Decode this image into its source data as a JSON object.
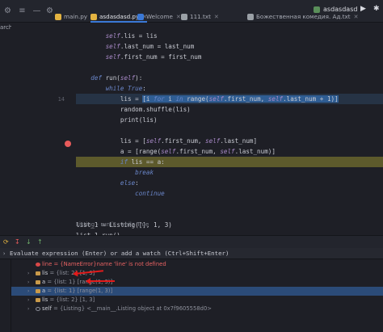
{
  "tabs": [
    {
      "label": "main.py",
      "active": false,
      "icon_color": "#e3b341"
    },
    {
      "label": "asdasdasd.py",
      "active": true,
      "icon_color": "#e3b341"
    },
    {
      "label": "Welcome",
      "active": false,
      "icon_color": "#3a78d6"
    },
    {
      "label": "111.txt",
      "active": false,
      "icon_color": "#9aa0a6"
    },
    {
      "label": "Божественная комедия. Ад.txt",
      "active": false,
      "icon_color": "#9aa0a6"
    }
  ],
  "run_config": {
    "name": "asdasdasd"
  },
  "left_panel": {
    "search_label": "arch"
  },
  "code_lines": [
    {
      "no": "",
      "html": "        <span class='self'>self</span>.lis = lis"
    },
    {
      "no": "",
      "html": "        <span class='self'>self</span>.last_num = last_num"
    },
    {
      "no": "",
      "html": "        <span class='self'>self</span>.first_num = first_num"
    },
    {
      "no": "",
      "html": ""
    },
    {
      "no": "",
      "html": "    <span class='kw'>def</span> run(<span class='self'>self</span>):"
    },
    {
      "no": "",
      "html": "        <span class='kw'>while True</span>:"
    },
    {
      "no": "14",
      "html": "            lis = <span class='sel'>[i <span class='kw'>for</span> i <span class='kw'>in</span> range(<span class='self'>self</span>.first_num, <span class='self'>self</span>.last_num + 1)]</span>"
    },
    {
      "no": "",
      "html": "            random.shuffle(lis)"
    },
    {
      "no": "",
      "html": "            print(lis)"
    },
    {
      "no": "",
      "html": ""
    },
    {
      "no": "",
      "html": "            lis = [<span class='self'>self</span>.first_num, <span class='self'>self</span>.last_num]"
    },
    {
      "no": "",
      "html": "            a = [range(<span class='self'>self</span>.first_num, <span class='self'>self</span>.last_num)]"
    },
    {
      "no": "",
      "html": "            <span class='kw'>if</span> lis == a:"
    },
    {
      "no": "",
      "html": "                <span class='kw'>break</span>"
    },
    {
      "no": "",
      "html": "            <span class='kw'>else</span>:"
    },
    {
      "no": "",
      "html": "                <span class='kw'>continue</span>"
    },
    {
      "no": "",
      "html": ""
    },
    {
      "no": "",
      "html": ""
    },
    {
      "no": "",
      "html": "list_1 = Listing([], 1, 3)"
    },
    {
      "no": "",
      "html": "list_1.run()"
    }
  ],
  "breadcrumb": {
    "parts": [
      "Listing",
      "run()",
      "while True"
    ]
  },
  "evaluate": {
    "placeholder": "Evaluate expression (Enter) or add a watch (Ctrl+Shift+Enter)"
  },
  "variables": [
    {
      "name": "line",
      "value": " = {NameError}name 'line' is not defined",
      "kind": "error",
      "expandable": false
    },
    {
      "name": "lis",
      "value": " = {list: 2} [1, 3]",
      "kind": "list",
      "expandable": true
    },
    {
      "name": "a",
      "value": " = {list: 1} [range(1, 3)]",
      "kind": "list",
      "expandable": true
    },
    {
      "name": "a",
      "value": " = {list: 1} [range(1, 3)]",
      "kind": "list",
      "expandable": true,
      "selected": true
    },
    {
      "name": "lis",
      "value": " = {list: 2} [1, 3]",
      "kind": "list",
      "expandable": true
    },
    {
      "name": "self",
      "value": " = {Listing} <__main__.Listing object at 0x7f9605558d0>",
      "kind": "object",
      "expandable": true
    }
  ],
  "colors": {
    "accent": "#3a78d6",
    "breakpoint": "#e85b5b",
    "annotation_arrow": "#e21b1b"
  }
}
